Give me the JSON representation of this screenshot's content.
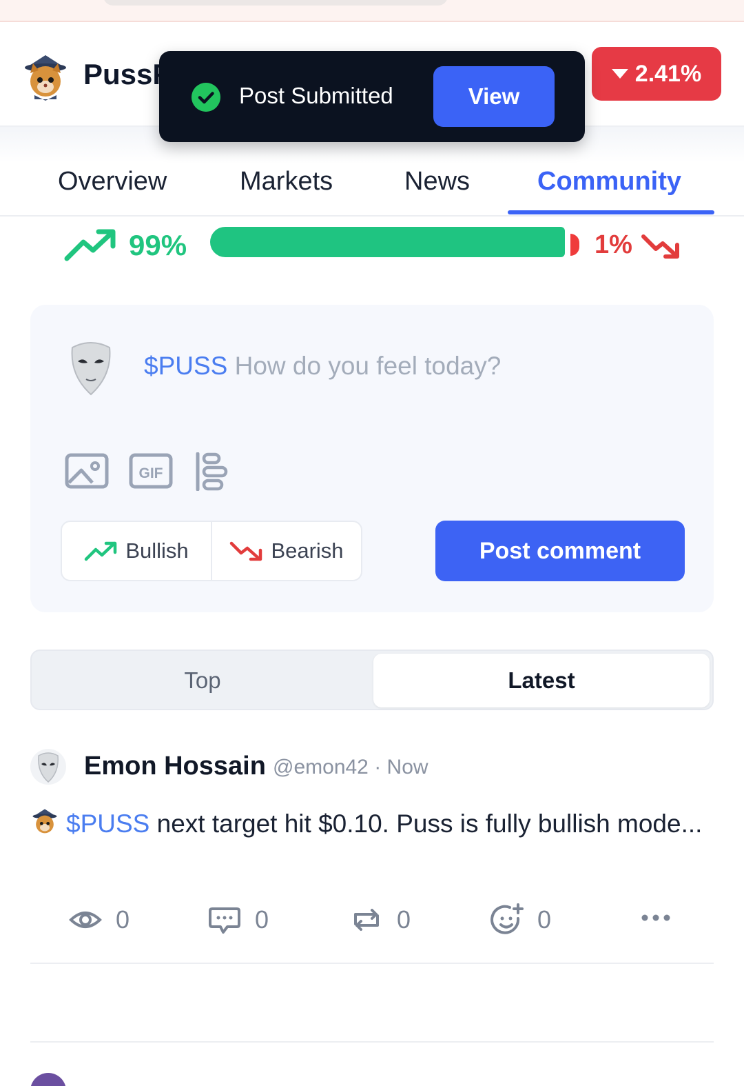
{
  "header": {
    "token_name": "PussF",
    "price_change": "2.41%",
    "price_change_color": "#e63a45"
  },
  "toast": {
    "message": "Post Submitted",
    "action_label": "View"
  },
  "tabs": [
    {
      "label": "Overview",
      "active": false
    },
    {
      "label": "Markets",
      "active": false
    },
    {
      "label": "News",
      "active": false
    },
    {
      "label": "Community",
      "active": true
    }
  ],
  "sentiment": {
    "bullish_label": "99%",
    "bearish_label": "1%",
    "bullish_fraction": 0.99,
    "bearish_fraction": 0.01,
    "bullish_color": "#1fc481",
    "bearish_color": "#ef3b3b"
  },
  "composer": {
    "ticker": "$PUSS",
    "placeholder": "How do you feel today?",
    "tools": [
      "image-icon",
      "gif-icon",
      "poll-icon"
    ],
    "bullish_label": "Bullish",
    "bearish_label": "Bearish",
    "submit_label": "Post comment"
  },
  "sort": {
    "options": [
      "Top",
      "Latest"
    ],
    "selected": "Latest"
  },
  "post": {
    "author": "Emon Hossain",
    "handle": "@emon42 · Now",
    "ticker": "$PUSS",
    "text": " next target hit $0.10. Puss is fully bullish mode...",
    "stats": {
      "views": "0",
      "comments": "0",
      "reposts": "0",
      "reactions": "0"
    }
  },
  "accent_color": "#3b63f6"
}
